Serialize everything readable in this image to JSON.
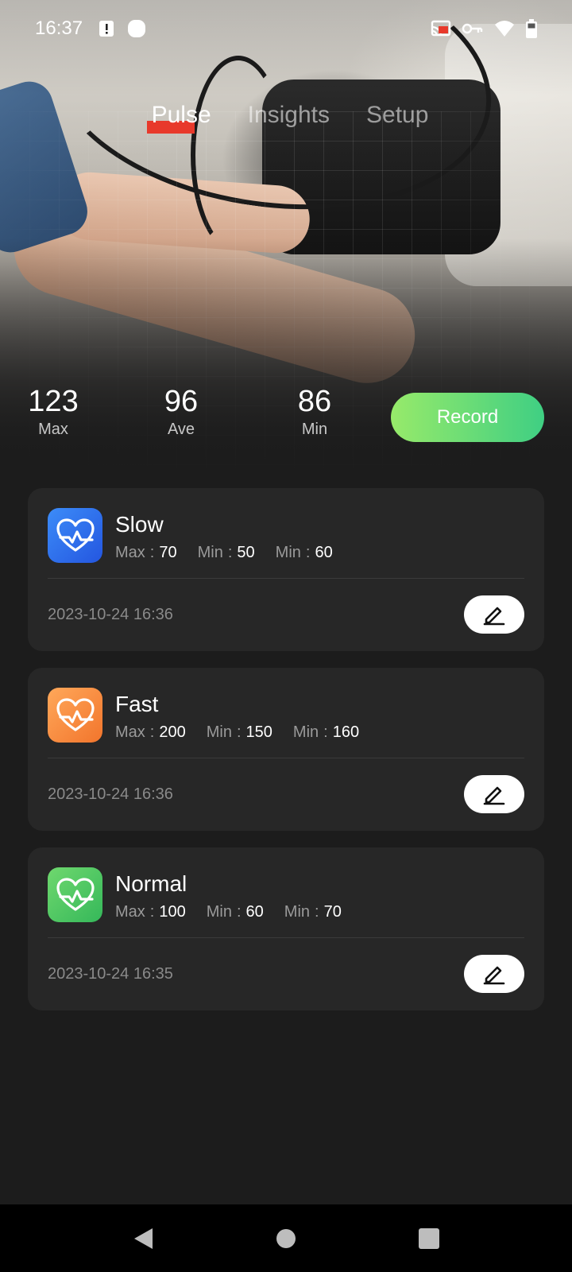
{
  "status_bar": {
    "time": "16:37",
    "left_icons": [
      "alert-notification-icon",
      "app-notification-icon"
    ],
    "right_icons": [
      "cast-icon",
      "vpn-key-icon",
      "wifi-icon",
      "battery-icon"
    ]
  },
  "tabs": [
    {
      "label": "Pulse",
      "active": true
    },
    {
      "label": "Insights",
      "active": false
    },
    {
      "label": "Setup",
      "active": false
    }
  ],
  "stats": {
    "max": {
      "value": "123",
      "label": "Max"
    },
    "ave": {
      "value": "96",
      "label": "Ave"
    },
    "min": {
      "value": "86",
      "label": "Min"
    }
  },
  "record_button": {
    "label": "Record"
  },
  "records": [
    {
      "title": "Slow",
      "icon": "heart-pulse-icon",
      "color": "#2f6ff0",
      "metrics": [
        {
          "key": "Max",
          "sep": ":",
          "value": "70"
        },
        {
          "key": "Min",
          "sep": ":",
          "value": "50"
        },
        {
          "key": "Min",
          "sep": ":",
          "value": "60"
        }
      ],
      "date": "2023-10-24 16:36"
    },
    {
      "title": "Fast",
      "icon": "heart-pulse-icon",
      "color": "#f58a3c",
      "metrics": [
        {
          "key": "Max",
          "sep": ":",
          "value": "200"
        },
        {
          "key": "Min",
          "sep": ":",
          "value": "150"
        },
        {
          "key": "Min",
          "sep": ":",
          "value": "160"
        }
      ],
      "date": "2023-10-24 16:36"
    },
    {
      "title": "Normal",
      "icon": "heart-pulse-icon",
      "color": "#3ebd5f",
      "metrics": [
        {
          "key": "Max",
          "sep": ":",
          "value": "100"
        },
        {
          "key": "Min",
          "sep": ":",
          "value": "60"
        },
        {
          "key": "Min",
          "sep": ":",
          "value": "70"
        }
      ],
      "date": "2023-10-24 16:35"
    }
  ],
  "nav_bar": {
    "buttons": [
      "back-icon",
      "home-icon",
      "recents-icon"
    ]
  }
}
